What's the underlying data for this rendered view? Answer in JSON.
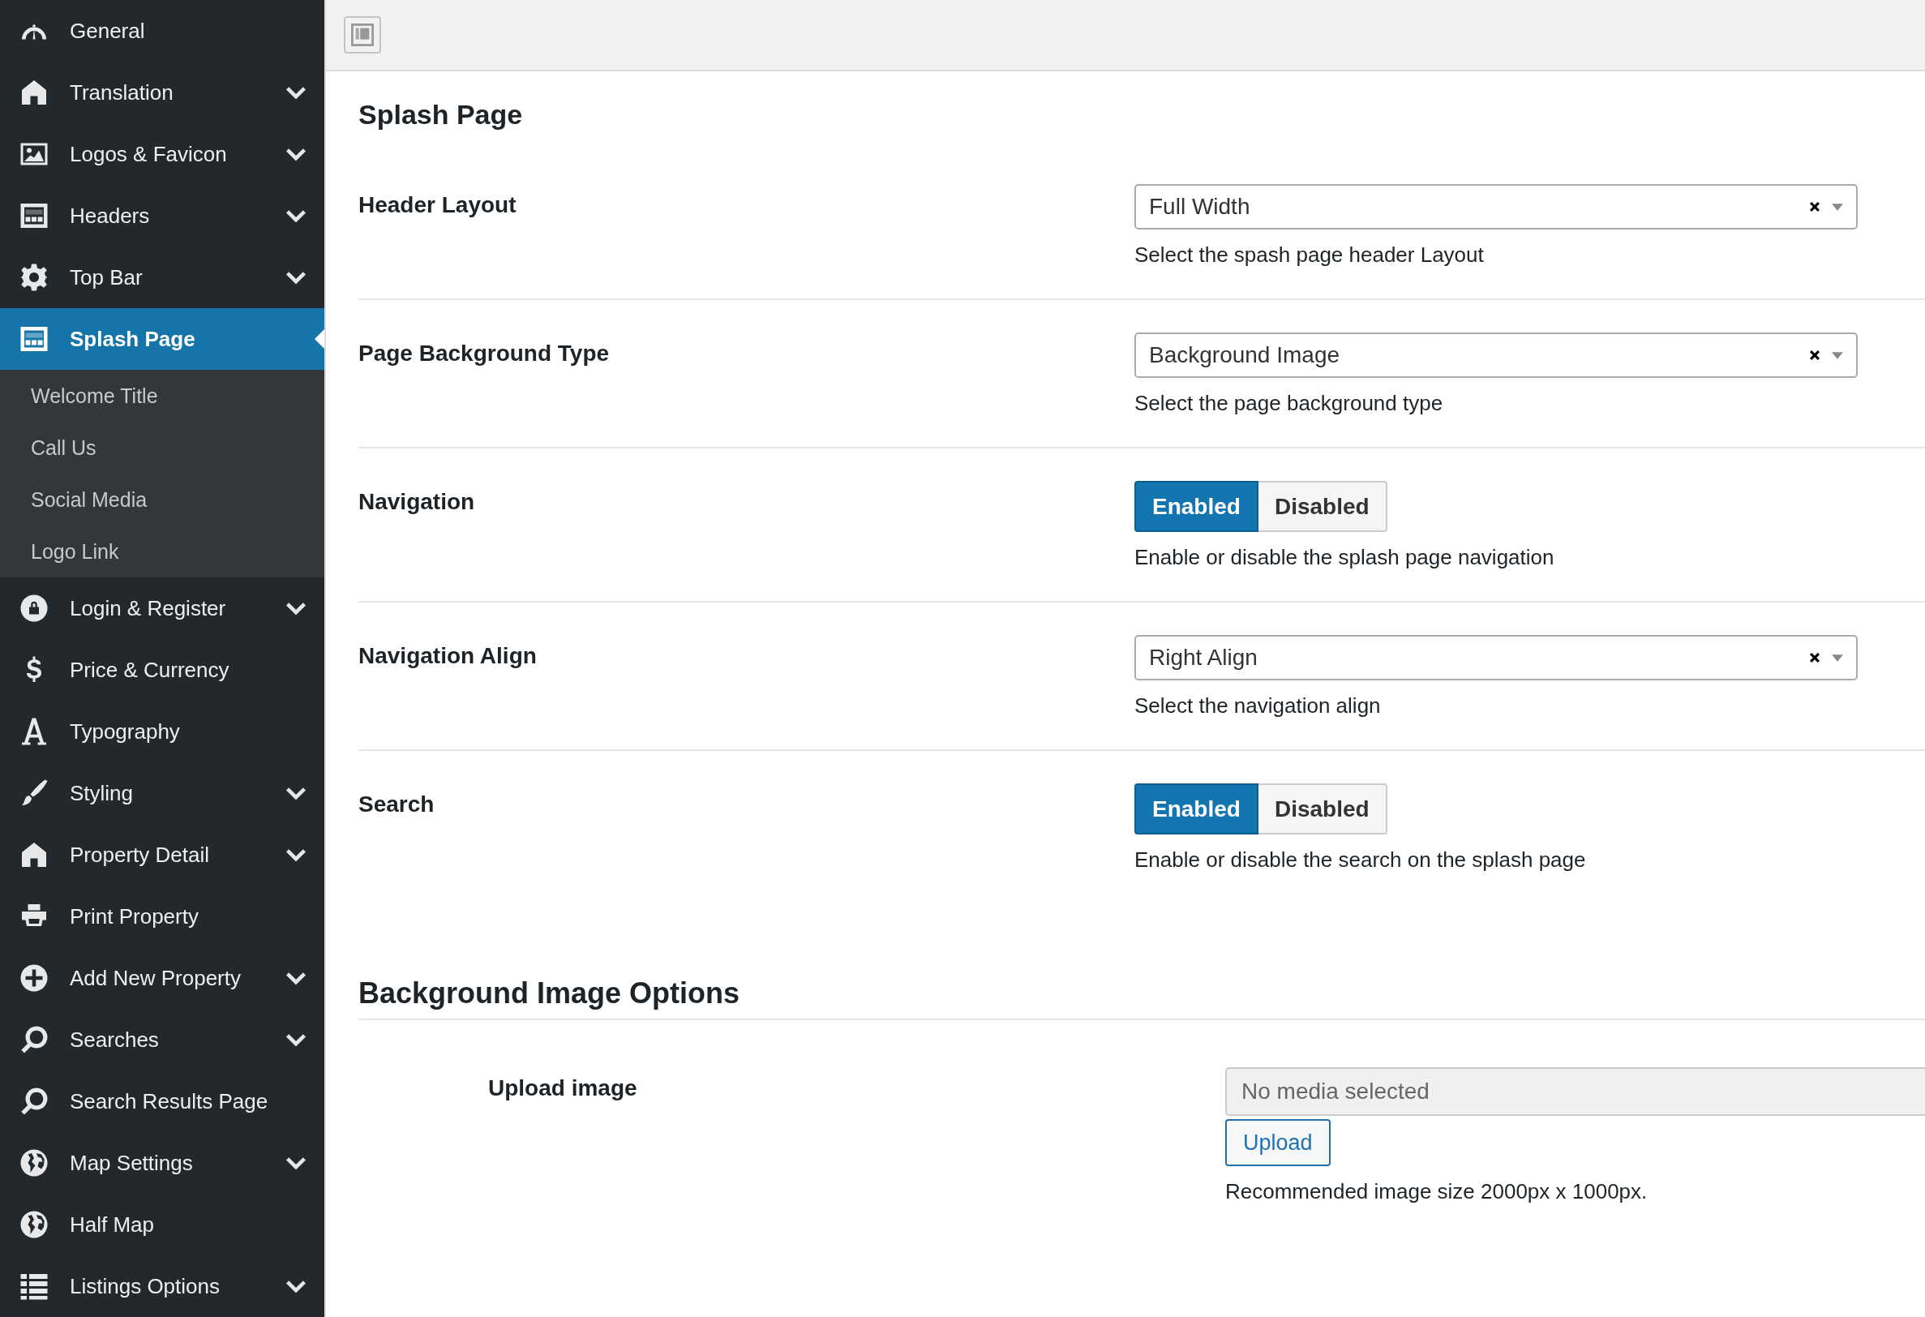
{
  "sidebar": {
    "items": [
      {
        "label": "General",
        "has_submenu": false,
        "selected": false
      },
      {
        "label": "Translation",
        "has_submenu": true,
        "selected": false
      },
      {
        "label": "Logos & Favicon",
        "has_submenu": true,
        "selected": false
      },
      {
        "label": "Headers",
        "has_submenu": true,
        "selected": false
      },
      {
        "label": "Top Bar",
        "has_submenu": true,
        "selected": false
      },
      {
        "label": "Splash Page",
        "has_submenu": false,
        "selected": true,
        "children": [
          {
            "label": "Welcome Title",
            "selected": false
          },
          {
            "label": "Call Us",
            "selected": false
          },
          {
            "label": "Social Media",
            "selected": false
          },
          {
            "label": "Logo Link",
            "selected": false
          }
        ]
      },
      {
        "label": "Login & Register",
        "has_submenu": true,
        "selected": false
      },
      {
        "label": "Price & Currency",
        "has_submenu": false,
        "selected": false
      },
      {
        "label": "Typography",
        "has_submenu": false,
        "selected": false
      },
      {
        "label": "Styling",
        "has_submenu": true,
        "selected": false
      },
      {
        "label": "Property Detail",
        "has_submenu": true,
        "selected": false
      },
      {
        "label": "Print Property",
        "has_submenu": false,
        "selected": false
      },
      {
        "label": "Add New Property",
        "has_submenu": true,
        "selected": false
      },
      {
        "label": "Searches",
        "has_submenu": true,
        "selected": false
      },
      {
        "label": "Search Results Page",
        "has_submenu": false,
        "selected": false
      },
      {
        "label": "Map Settings",
        "has_submenu": true,
        "selected": false
      },
      {
        "label": "Half Map",
        "has_submenu": false,
        "selected": false
      },
      {
        "label": "Listings Options",
        "has_submenu": true,
        "selected": false
      }
    ]
  },
  "section": {
    "title": "Splash Page",
    "fields": [
      {
        "kind": "select",
        "label": "Header Layout",
        "value": "Full Width",
        "description": "Select the spash page header Layout"
      },
      {
        "kind": "select",
        "label": "Page Background Type",
        "value": "Background Image",
        "description": "Select the page background type"
      },
      {
        "kind": "toggle",
        "label": "Navigation",
        "options": [
          {
            "label": "Enabled",
            "selected": true
          },
          {
            "label": "Disabled",
            "selected": false
          }
        ],
        "description": "Enable or disable the splash page navigation"
      },
      {
        "kind": "select",
        "label": "Navigation Align",
        "value": "Right Align",
        "description": "Select the navigation align"
      },
      {
        "kind": "toggle",
        "label": "Search",
        "options": [
          {
            "label": "Enabled",
            "selected": true
          },
          {
            "label": "Disabled",
            "selected": false
          }
        ],
        "description": "Enable or disable the search on the splash page"
      }
    ]
  },
  "subsection": {
    "title": "Background Image Options",
    "fields": [
      {
        "kind": "media",
        "label": "Upload image",
        "placeholder": "No media selected",
        "button": "Upload",
        "description": "Recommended image size 2000px x 1000px."
      }
    ]
  }
}
